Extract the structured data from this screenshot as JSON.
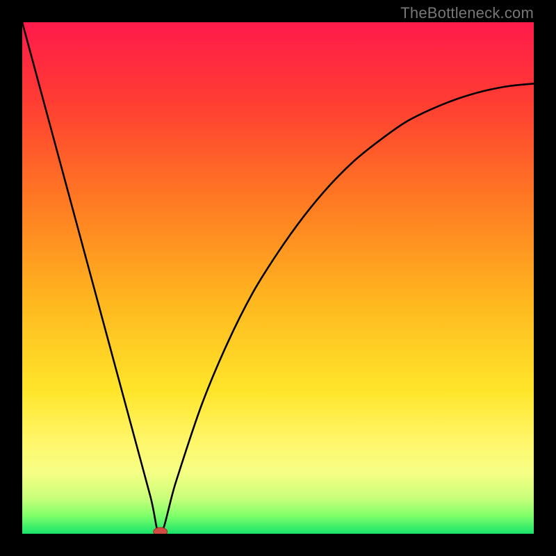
{
  "watermark": "TheBottleneck.com",
  "chart_data": {
    "type": "line",
    "title": "",
    "xlabel": "",
    "ylabel": "",
    "xlim": [
      0,
      100
    ],
    "ylim": [
      0,
      100
    ],
    "x": [
      0,
      5,
      10,
      15,
      20,
      25,
      27,
      30,
      35,
      40,
      45,
      50,
      55,
      60,
      65,
      70,
      75,
      80,
      85,
      90,
      95,
      100
    ],
    "values": [
      100,
      81.5,
      63,
      44.5,
      26,
      7.5,
      0,
      10,
      25,
      37,
      47,
      55,
      62,
      68,
      73,
      77,
      80.5,
      83,
      85,
      86.5,
      87.5,
      88
    ],
    "notes": "V-shaped bottleneck curve. Minimum (0) occurs near x≈27. Left branch is linear from (0,100) to (27,0); right branch rises with diminishing slope toward ~88 at x=100. Background is a vertical red→orange→yellow→green gradient. A small red lozenge marks the minimum."
  },
  "gradient_stops": [
    {
      "offset": 0.0,
      "color": "#ff1a4b"
    },
    {
      "offset": 0.15,
      "color": "#ff3b33"
    },
    {
      "offset": 0.35,
      "color": "#ff7a22"
    },
    {
      "offset": 0.55,
      "color": "#ffb81f"
    },
    {
      "offset": 0.72,
      "color": "#ffe52a"
    },
    {
      "offset": 0.82,
      "color": "#fff66a"
    },
    {
      "offset": 0.88,
      "color": "#f6ff85"
    },
    {
      "offset": 0.93,
      "color": "#c9ff7a"
    },
    {
      "offset": 0.965,
      "color": "#7eff6a"
    },
    {
      "offset": 1.0,
      "color": "#19e36b"
    }
  ],
  "marker": {
    "fill": "#d24a42",
    "stroke": "#9c2e28",
    "rx": 10,
    "ry": 6
  }
}
